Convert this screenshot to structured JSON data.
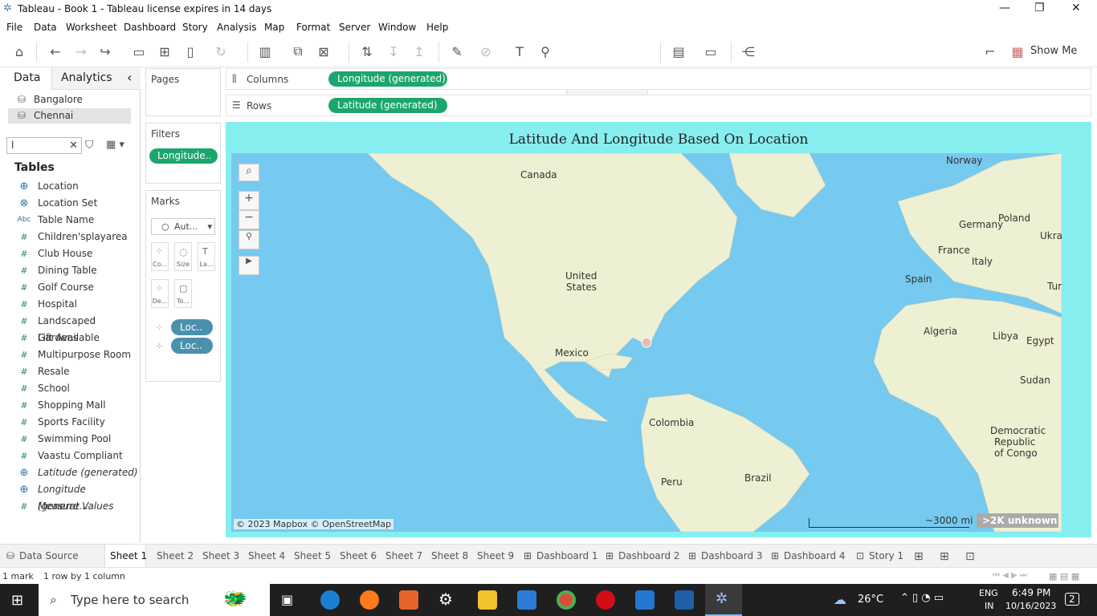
{
  "window": {
    "title": "Tableau - Book 1 - Tableau license expires in 14 days",
    "minimize": "—",
    "restore": "❐",
    "close": "✕"
  },
  "menu": [
    "File",
    "Data",
    "Worksheet",
    "Dashboard",
    "Story",
    "Analysis",
    "Map",
    "Format",
    "Server",
    "Window",
    "Help"
  ],
  "toolbar": {
    "show_me": "Show Me"
  },
  "left": {
    "tab_data": "Data",
    "tab_analytics": "Analytics",
    "collapse": "‹",
    "datasources": [
      "Bangalore",
      "Chennai"
    ],
    "search_value": "l",
    "tables_heading": "Tables",
    "fields": [
      {
        "name": "Location",
        "icon": "globe-icon",
        "glyph": "⊕",
        "italic": false
      },
      {
        "name": "Location Set",
        "icon": "set-icon",
        "glyph": "⊗",
        "italic": false
      },
      {
        "name": "Table Name",
        "icon": "abc-icon",
        "glyph": "Abc",
        "italic": false
      },
      {
        "name": "Children'splayarea",
        "icon": "hash-icon",
        "glyph": "#",
        "italic": false
      },
      {
        "name": "Club House",
        "icon": "hash-icon",
        "glyph": "#",
        "italic": false
      },
      {
        "name": "Dining Table",
        "icon": "hash-icon",
        "glyph": "#",
        "italic": false
      },
      {
        "name": "Golf Course",
        "icon": "hash-icon",
        "glyph": "#",
        "italic": false
      },
      {
        "name": "Hospital",
        "icon": "hash-icon",
        "glyph": "#",
        "italic": false
      },
      {
        "name": "Landscaped Gardens",
        "icon": "hash-icon",
        "glyph": "#",
        "italic": false
      },
      {
        "name": "Lift Available",
        "icon": "hash-icon",
        "glyph": "#",
        "italic": false
      },
      {
        "name": "Multipurpose Room",
        "icon": "hash-icon",
        "glyph": "#",
        "italic": false
      },
      {
        "name": "Resale",
        "icon": "hash-icon",
        "glyph": "#",
        "italic": false
      },
      {
        "name": "School",
        "icon": "hash-icon",
        "glyph": "#",
        "italic": false
      },
      {
        "name": "Shopping Mall",
        "icon": "hash-icon",
        "glyph": "#",
        "italic": false
      },
      {
        "name": "Sports Facility",
        "icon": "hash-icon",
        "glyph": "#",
        "italic": false
      },
      {
        "name": "Swimming Pool",
        "icon": "hash-icon",
        "glyph": "#",
        "italic": false
      },
      {
        "name": "Vaastu Compliant",
        "icon": "hash-icon",
        "glyph": "#",
        "italic": false
      },
      {
        "name": "Latitude (generated)",
        "icon": "globe-icon",
        "glyph": "⊕",
        "italic": true
      },
      {
        "name": "Longitude (generat...",
        "icon": "globe-icon",
        "glyph": "⊕",
        "italic": true
      },
      {
        "name": "Measure Values",
        "icon": "hash-icon",
        "glyph": "#",
        "italic": true
      }
    ]
  },
  "cards": {
    "pages": "Pages",
    "filters": "Filters",
    "filter_pill": "Longitude..",
    "marks": "Marks",
    "mark_type": "Aut...",
    "mark_buttons": [
      "Co...",
      "Size",
      "La...",
      "De...",
      "To..."
    ],
    "mark_pills": [
      "Loc..",
      "Loc.."
    ]
  },
  "shelves": {
    "columns_label": "Columns",
    "columns_pill": "Longitude (generated)",
    "rows_label": "Rows",
    "rows_pill": "Latitude (generated)"
  },
  "viz": {
    "title": "Latitude And Longitude Based On Location",
    "map_labels": [
      "Canada",
      "Norway",
      "Poland",
      "Germany",
      "Ukraine",
      "France",
      "Italy",
      "United",
      "States",
      "Spain",
      "Turke",
      "Algeria",
      "Libya",
      "Egypt",
      "Mexico",
      "Sudan",
      "Colombia",
      "Democratic",
      "Republic",
      "of Congo",
      "Peru",
      "Brazil"
    ],
    "attribution": "© 2023 Mapbox © OpenStreetMap",
    "scale": "~3000 mi",
    "unknown": ">2K unknown",
    "colors": {
      "background": "#87eef0",
      "ocean": "#76c9ef",
      "land": "#eef0d3",
      "mark": "#e8bdb4"
    }
  },
  "sheet_tabs": [
    "Data Source",
    "Sheet 1",
    "Sheet 2",
    "Sheet 3",
    "Sheet 4",
    "Sheet 5",
    "Sheet 6",
    "Sheet 7",
    "Sheet 8",
    "Sheet 9",
    "Dashboard 1",
    "Dashboard 2",
    "Dashboard 3",
    "Dashboard 4",
    "Story 1"
  ],
  "status": {
    "marks": "1 mark",
    "dims": "1 row by 1 column"
  },
  "taskbar": {
    "search": "Type here to search",
    "weather": "26°C",
    "lang1": "ENG",
    "lang2": "IN",
    "time": "6:49 PM",
    "date": "10/16/2023",
    "notif": "2"
  }
}
